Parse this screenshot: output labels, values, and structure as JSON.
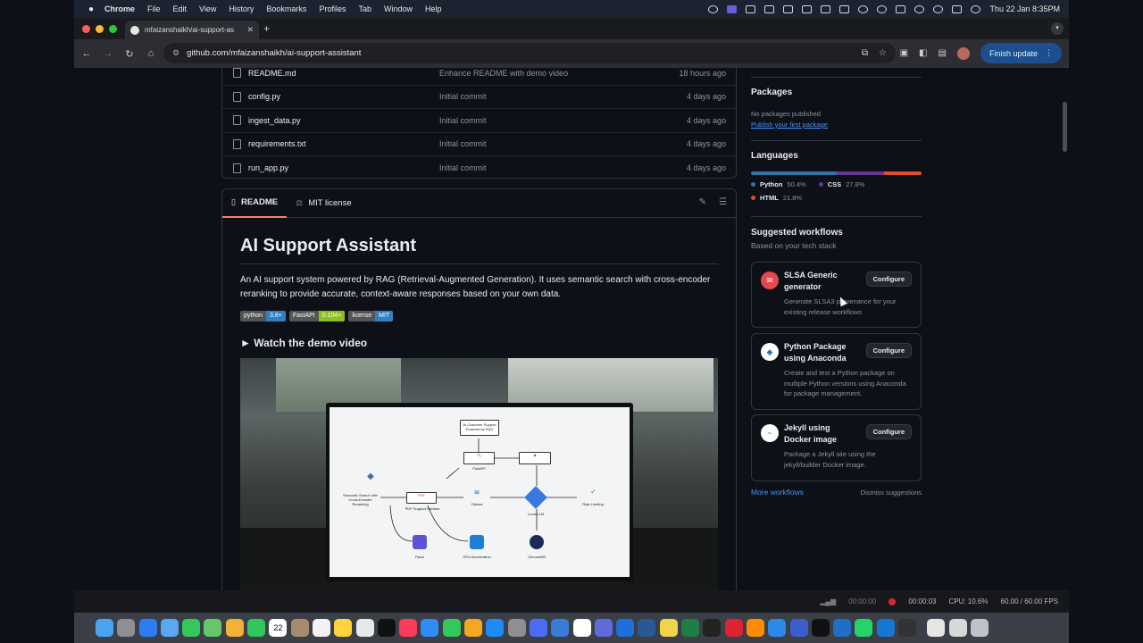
{
  "menubar": {
    "app": "Chrome",
    "items": [
      "File",
      "Edit",
      "View",
      "History",
      "Bookmarks",
      "Profiles",
      "Tab",
      "Window",
      "Help"
    ],
    "clock": "Thu 22 Jan  8:35PM"
  },
  "browser": {
    "tab_title": "mfaizanshaikh/ai-support-as",
    "url": "github.com/mfaizanshaikh/ai-support-assistant",
    "finish_update": "Finish update"
  },
  "files": [
    {
      "name": "README.md",
      "commit": "Enhance README with demo video",
      "time": "18 hours ago"
    },
    {
      "name": "config.py",
      "commit": "Initial commit",
      "time": "4 days ago"
    },
    {
      "name": "ingest_data.py",
      "commit": "Initial commit",
      "time": "4 days ago"
    },
    {
      "name": "requirements.txt",
      "commit": "Initial commit",
      "time": "4 days ago"
    },
    {
      "name": "run_app.py",
      "commit": "Initial commit",
      "time": "4 days ago"
    }
  ],
  "readme": {
    "tab_readme": "README",
    "tab_license": "MIT license",
    "title": "AI Support Assistant",
    "description": "An AI support system powered by RAG (Retrieval-Augmented Generation). It uses semantic search with cross-encoder reranking to provide accurate, context-aware responses based on your own data.",
    "badges": [
      {
        "label": "python",
        "value": "3.8+",
        "color": "#2f80c5"
      },
      {
        "label": "FastAPI",
        "value": "0.104+",
        "color": "#8dbf1e"
      },
      {
        "label": "license",
        "value": "MIT",
        "color": "#2f80c5"
      }
    ],
    "demo_heading": "► Watch the demo video"
  },
  "diagram": {
    "top": "AI Customer Support Powered by RAG",
    "fastapi": "FastAPI",
    "semantic": "Semantic Search with Cross-Encoder Reranking",
    "pdf": "PDF Support Savines",
    "ollama": "Ollama",
    "local_llm": "Local LLM",
    "rate": "Rate Limiting",
    "python": "Pyton",
    "gpu": "GPU Acceleration",
    "chroma": "ChromaDB"
  },
  "sidebar": {
    "packages_title": "Packages",
    "no_packages": "No packages published",
    "publish_link": "Publish your first package",
    "languages_title": "Languages",
    "languages": [
      {
        "name": "Python",
        "pct": "50.4%",
        "color": "#3572A5",
        "share": 50.4
      },
      {
        "name": "CSS",
        "pct": "27.8%",
        "color": "#663399",
        "share": 27.8
      },
      {
        "name": "HTML",
        "pct": "21.8%",
        "color": "#e34c26",
        "share": 21.8
      }
    ],
    "workflows_title": "Suggested workflows",
    "workflows_sub": "Based on your tech stack",
    "workflows": [
      {
        "name": "SLSA Generic generator",
        "desc": "Generate SLSA3 provenance for your existing release workflows",
        "button": "Configure"
      },
      {
        "name": "Python Package using Anaconda",
        "desc": "Create and test a Python package on multiple Python versions using Anaconda for package management.",
        "button": "Configure"
      },
      {
        "name": "Jekyll using Docker image",
        "desc": "Package a Jekyll site using the jekyll/builder Docker image.",
        "button": "Configure"
      }
    ],
    "more_workflows": "More workflows",
    "dismiss": "Dismiss suggestions"
  },
  "status": {
    "timer1": "00:00:00",
    "timer2": "00:00:03",
    "cpu": "CPU: 10.6%",
    "fps": "60.00 / 60.00 FPS"
  },
  "dock": {
    "calendar_day": "22"
  }
}
